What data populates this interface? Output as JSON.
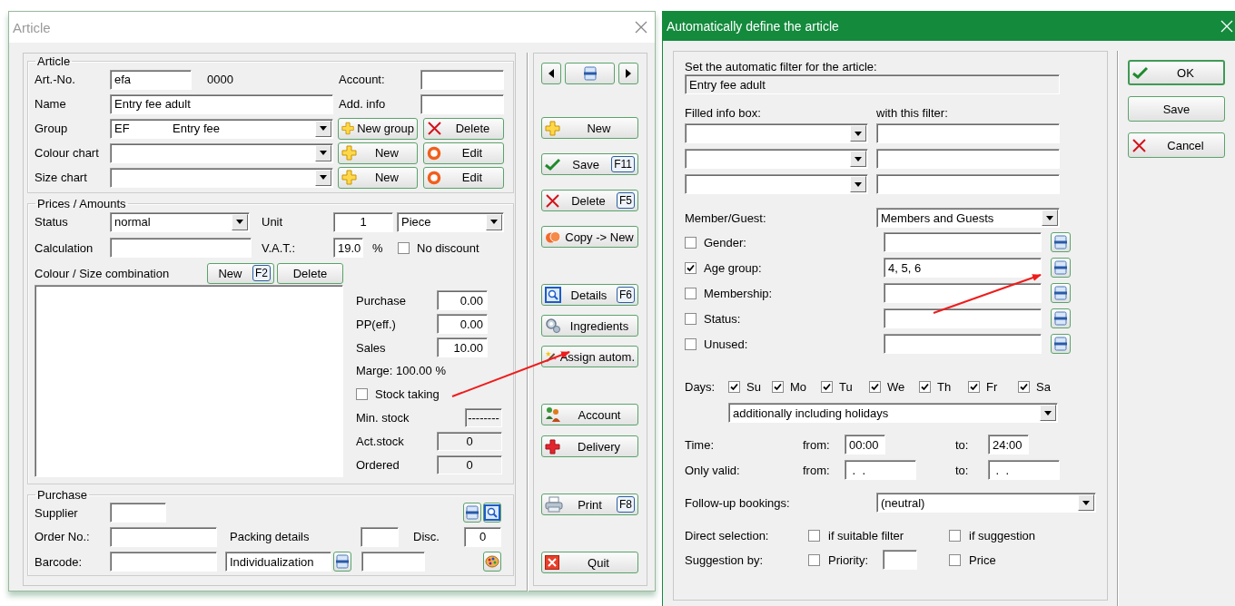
{
  "article": {
    "title": "Article",
    "article_box": {
      "legend": "Article",
      "art_no": {
        "label": "Art.-No.",
        "value": "efa",
        "code": "0000"
      },
      "account": {
        "label": "Account:"
      },
      "name": {
        "label": "Name",
        "value": "Entry fee adult"
      },
      "add_info": {
        "label": "Add. info"
      },
      "group": {
        "label": "Group",
        "code": "EF",
        "value": "Entry fee",
        "buttons": [
          {
            "label": "New group",
            "kind": "plus"
          },
          {
            "label": "Delete",
            "kind": "cross"
          }
        ]
      },
      "colour_chart": {
        "label": "Colour chart",
        "buttons": [
          {
            "label": "New",
            "kind": "plus"
          },
          {
            "label": "Edit",
            "kind": "ring"
          }
        ]
      },
      "size_chart": {
        "label": "Size chart",
        "buttons": [
          {
            "label": "New",
            "kind": "plus"
          },
          {
            "label": "Edit",
            "kind": "ring"
          }
        ]
      }
    },
    "prices_box": {
      "legend": "Prices / Amounts",
      "status": {
        "label": "Status",
        "value": "normal"
      },
      "unit": {
        "label": "Unit",
        "value": "1",
        "unit": "Piece"
      },
      "calculation": {
        "label": "Calculation"
      },
      "vat": {
        "label": "V.A.T.:",
        "value": "19.0",
        "suffix": "%"
      },
      "no_discount": {
        "label": "No discount",
        "checked": false
      },
      "combination": {
        "label": "Colour / Size combination",
        "new": "New",
        "new_key": "F2",
        "delete": "Delete"
      },
      "amounts": [
        {
          "label": "Purchase",
          "value": "0.00"
        },
        {
          "label": "PP(eff.)",
          "value": "0.00"
        },
        {
          "label": "Sales",
          "value": "10.00"
        }
      ],
      "marge": "Marge: 100.00 %",
      "stock_taking": {
        "label": "Stock taking",
        "checked": false
      },
      "stock": [
        {
          "label": "Min. stock",
          "value": "--------"
        },
        {
          "label": "Act.stock",
          "value": "0"
        },
        {
          "label": "Ordered",
          "value": "0"
        }
      ]
    },
    "purchase_box": {
      "legend": "Purchase",
      "supplier": "Supplier",
      "order_no": "Order No.:",
      "packing": "Packing details",
      "disc": {
        "label": "Disc.",
        "value": "0"
      },
      "barcode": "Barcode:",
      "individualization": "Individualization"
    },
    "action_groups": [
      [
        {
          "label": "New",
          "kind": "plus"
        },
        {
          "label": "Save",
          "key": "F11",
          "kind": "check"
        },
        {
          "label": "Delete",
          "key": "F5",
          "kind": "cross"
        },
        {
          "label": "Copy -> New",
          "kind": "copy"
        }
      ],
      [
        {
          "label": "Details",
          "key": "F6",
          "kind": "details"
        },
        {
          "label": "Ingredients",
          "kind": "gears"
        },
        {
          "label": "Assign autom.",
          "kind": "wand"
        }
      ],
      [
        {
          "label": "Account",
          "kind": "people"
        },
        {
          "label": "Delivery",
          "kind": "redcross"
        }
      ],
      [
        {
          "label": "Print",
          "key": "F8",
          "kind": "printer"
        }
      ],
      [
        {
          "label": "Quit",
          "kind": "quit"
        }
      ]
    ]
  },
  "auto_define": {
    "title": "Automatically define the article",
    "filter_label": "Set the automatic filter for the article:",
    "filter_value": "Entry fee adult",
    "info_box_label": "Filled info box:",
    "filter_col_label": "with this filter:",
    "member_guest": {
      "label": "Member/Guest:",
      "value": "Members and Guests"
    },
    "criteria": [
      {
        "label": "Gender:",
        "checked": false
      },
      {
        "label": "Age group:",
        "checked": true,
        "value": "4, 5, 6"
      },
      {
        "label": "Membership:",
        "checked": false
      },
      {
        "label": "Status:",
        "checked": false
      },
      {
        "label": "Unused:",
        "checked": false
      }
    ],
    "days": {
      "label": "Days:",
      "items": [
        {
          "label": "Su",
          "checked": true
        },
        {
          "label": "Mo",
          "checked": true
        },
        {
          "label": "Tu",
          "checked": true
        },
        {
          "label": "We",
          "checked": true
        },
        {
          "label": "Th",
          "checked": true
        },
        {
          "label": "Fr",
          "checked": true
        },
        {
          "label": "Sa",
          "checked": true
        }
      ]
    },
    "holidays": "additionally including holidays",
    "time": {
      "label": "Time:",
      "from_label": "from:",
      "from": "00:00",
      "to_label": "to:",
      "to": "24:00"
    },
    "valid": {
      "label": "Only valid:",
      "from_label": "from:",
      "from": " .  .",
      "to_label": "to:",
      "to": " .  ."
    },
    "follow_up": {
      "label": "Follow-up bookings:",
      "value": "(neutral)"
    },
    "direct_selection": {
      "label": "Direct selection:",
      "options": [
        {
          "label": "if suitable filter",
          "checked": false
        },
        {
          "label": "if suggestion",
          "checked": false
        }
      ]
    },
    "suggestion_by": {
      "label": "Suggestion by:",
      "priority": {
        "label": "Priority:",
        "checked": false
      },
      "price": {
        "label": "Price",
        "checked": false
      }
    },
    "buttons": [
      {
        "label": "OK",
        "kind": "check",
        "default": true
      },
      {
        "label": "Save",
        "kind": "none",
        "default": false
      },
      {
        "label": "Cancel",
        "kind": "cross",
        "default": false
      }
    ]
  }
}
